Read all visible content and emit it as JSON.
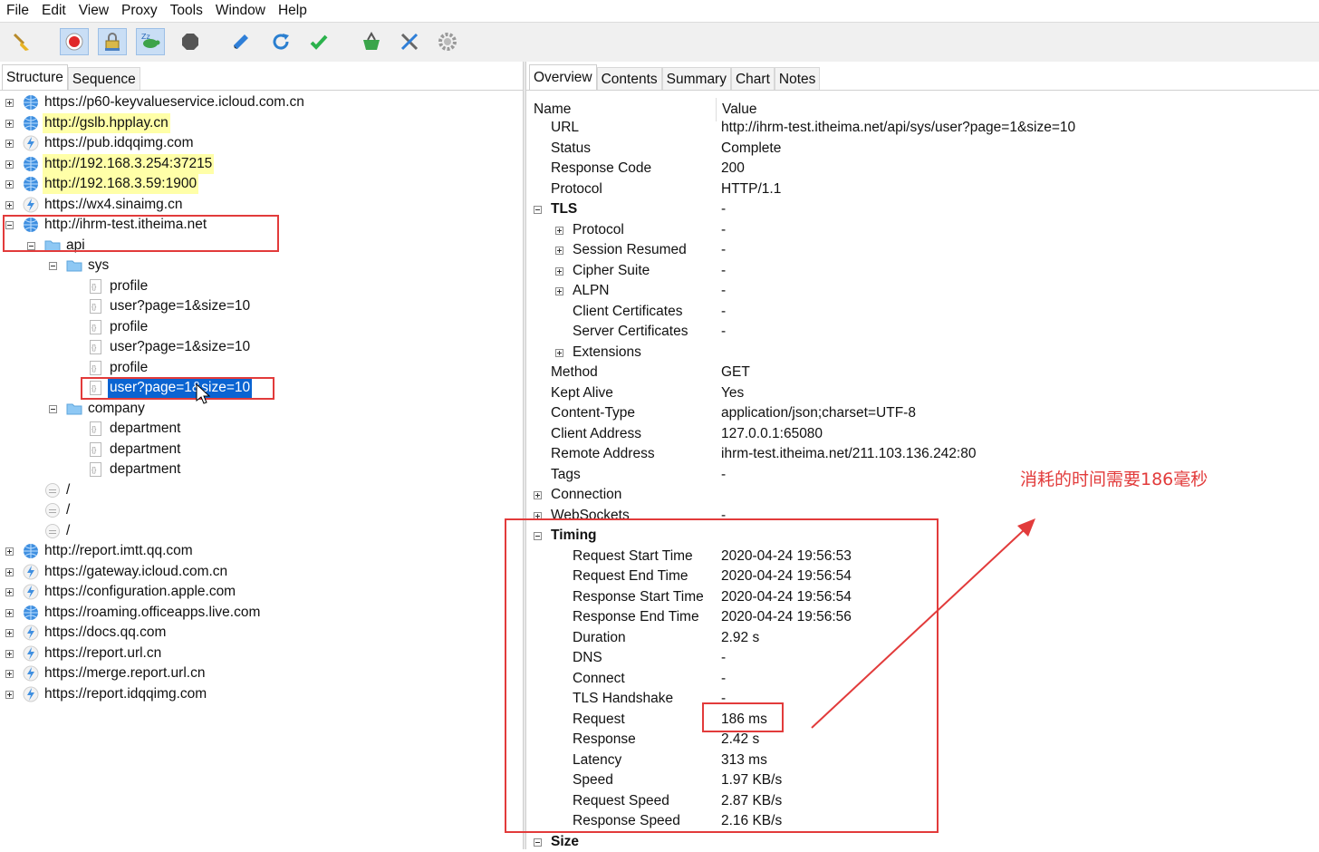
{
  "menu": [
    "File",
    "Edit",
    "View",
    "Proxy",
    "Tools",
    "Window",
    "Help"
  ],
  "toolbar_icons": [
    {
      "name": "broom-icon",
      "pressed": false
    },
    {
      "name": "record-icon",
      "pressed": true
    },
    {
      "name": "ssl-lock-icon",
      "pressed": true
    },
    {
      "name": "turtle-throttle-icon",
      "pressed": true
    },
    {
      "name": "stop-hex-icon",
      "pressed": false
    },
    {
      "name": "pen-icon",
      "pressed": false
    },
    {
      "name": "refresh-icon",
      "pressed": false
    },
    {
      "name": "check-icon",
      "pressed": false
    },
    {
      "name": "basket-icon",
      "pressed": false
    },
    {
      "name": "tools-icon",
      "pressed": false
    },
    {
      "name": "gear-icon",
      "pressed": false
    }
  ],
  "left_tabs": [
    "Structure",
    "Sequence"
  ],
  "right_tabs": [
    "Overview",
    "Contents",
    "Summary",
    "Chart",
    "Notes"
  ],
  "tree": {
    "hosts_top": [
      {
        "label": "https://p60-keyvalueservice.icloud.com.cn",
        "icon": "globe",
        "highlight": false
      },
      {
        "label": "http://gslb.hpplay.cn",
        "icon": "globe",
        "highlight": true
      },
      {
        "label": "https://pub.idqqimg.com",
        "icon": "bolt",
        "highlight": false
      },
      {
        "label": "http://192.168.3.254:37215",
        "icon": "globe",
        "highlight": true
      },
      {
        "label": "http://192.168.3.59:1900",
        "icon": "globe",
        "highlight": true
      },
      {
        "label": "https://wx4.sinaimg.cn",
        "icon": "bolt",
        "highlight": false
      }
    ],
    "expanded_host": "http://ihrm-test.itheima.net",
    "api": "api",
    "sys": "sys",
    "sys_items": [
      "profile",
      "user?page=1&size=10",
      "profile",
      "user?page=1&size=10",
      "profile",
      "user?page=1&size=10"
    ],
    "company": "company",
    "company_items": [
      "department",
      "department",
      "department"
    ],
    "slashes": [
      "/",
      "/",
      "/"
    ],
    "hosts_bottom": [
      {
        "label": "http://report.imtt.qq.com",
        "icon": "globe"
      },
      {
        "label": "https://gateway.icloud.com.cn",
        "icon": "bolt"
      },
      {
        "label": "https://configuration.apple.com",
        "icon": "bolt"
      },
      {
        "label": "https://roaming.officeapps.live.com",
        "icon": "globe"
      },
      {
        "label": "https://docs.qq.com",
        "icon": "bolt"
      },
      {
        "label": "https://report.url.cn",
        "icon": "bolt"
      },
      {
        "label": "https://merge.report.url.cn",
        "icon": "bolt"
      },
      {
        "label": "https://report.idqqimg.com",
        "icon": "bolt"
      }
    ]
  },
  "overview": {
    "col_name": "Name",
    "col_value": "Value",
    "rows": [
      {
        "name": "URL",
        "value": "http://ihrm-test.itheima.net/api/sys/user?page=1&size=10",
        "indent": 1,
        "exp": ""
      },
      {
        "name": "Status",
        "value": "Complete",
        "indent": 1,
        "exp": ""
      },
      {
        "name": "Response Code",
        "value": "200",
        "indent": 1,
        "exp": ""
      },
      {
        "name": "Protocol",
        "value": "HTTP/1.1",
        "indent": 1,
        "exp": ""
      },
      {
        "name": "TLS",
        "value": "-",
        "indent": 1,
        "exp": "minus",
        "bold": true
      },
      {
        "name": "Protocol",
        "value": "-",
        "indent": 2,
        "exp": "plus"
      },
      {
        "name": "Session Resumed",
        "value": "-",
        "indent": 2,
        "exp": "plus"
      },
      {
        "name": "Cipher Suite",
        "value": "-",
        "indent": 2,
        "exp": "plus"
      },
      {
        "name": "ALPN",
        "value": "-",
        "indent": 2,
        "exp": "plus"
      },
      {
        "name": "Client Certificates",
        "value": "-",
        "indent": 2,
        "exp": ""
      },
      {
        "name": "Server Certificates",
        "value": "-",
        "indent": 2,
        "exp": ""
      },
      {
        "name": "Extensions",
        "value": "",
        "indent": 2,
        "exp": "plus"
      },
      {
        "name": "Method",
        "value": "GET",
        "indent": 1,
        "exp": ""
      },
      {
        "name": "Kept Alive",
        "value": "Yes",
        "indent": 1,
        "exp": ""
      },
      {
        "name": "Content-Type",
        "value": "application/json;charset=UTF-8",
        "indent": 1,
        "exp": ""
      },
      {
        "name": "Client Address",
        "value": "127.0.0.1:65080",
        "indent": 1,
        "exp": ""
      },
      {
        "name": "Remote Address",
        "value": "ihrm-test.itheima.net/211.103.136.242:80",
        "indent": 1,
        "exp": ""
      },
      {
        "name": "Tags",
        "value": "-",
        "indent": 1,
        "exp": ""
      },
      {
        "name": "Connection",
        "value": "",
        "indent": 1,
        "exp": "plus"
      },
      {
        "name": "WebSockets",
        "value": "-",
        "indent": 1,
        "exp": "plus"
      },
      {
        "name": "Timing",
        "value": "",
        "indent": 1,
        "exp": "minus",
        "bold": true
      },
      {
        "name": "Request Start Time",
        "value": "2020-04-24 19:56:53",
        "indent": 2,
        "exp": ""
      },
      {
        "name": "Request End Time",
        "value": "2020-04-24 19:56:54",
        "indent": 2,
        "exp": ""
      },
      {
        "name": "Response Start Time",
        "value": "2020-04-24 19:56:54",
        "indent": 2,
        "exp": ""
      },
      {
        "name": "Response End Time",
        "value": "2020-04-24 19:56:56",
        "indent": 2,
        "exp": ""
      },
      {
        "name": "Duration",
        "value": "2.92 s",
        "indent": 2,
        "exp": ""
      },
      {
        "name": "DNS",
        "value": "-",
        "indent": 2,
        "exp": ""
      },
      {
        "name": "Connect",
        "value": "-",
        "indent": 2,
        "exp": ""
      },
      {
        "name": "TLS Handshake",
        "value": "-",
        "indent": 2,
        "exp": ""
      },
      {
        "name": "Request",
        "value": "186 ms",
        "indent": 2,
        "exp": ""
      },
      {
        "name": "Response",
        "value": "2.42 s",
        "indent": 2,
        "exp": ""
      },
      {
        "name": "Latency",
        "value": "313 ms",
        "indent": 2,
        "exp": ""
      },
      {
        "name": "Speed",
        "value": "1.97 KB/s",
        "indent": 2,
        "exp": ""
      },
      {
        "name": "Request Speed",
        "value": "2.87 KB/s",
        "indent": 2,
        "exp": ""
      },
      {
        "name": "Response Speed",
        "value": "2.16 KB/s",
        "indent": 2,
        "exp": ""
      },
      {
        "name": "Size",
        "value": "",
        "indent": 1,
        "exp": "minus",
        "bold": true
      }
    ]
  },
  "annotation": "消耗的时间需要186毫秒",
  "colors": {
    "annotation": "#e23b3b",
    "selection": "#0a64d2",
    "highlight": "#ffffa8"
  }
}
